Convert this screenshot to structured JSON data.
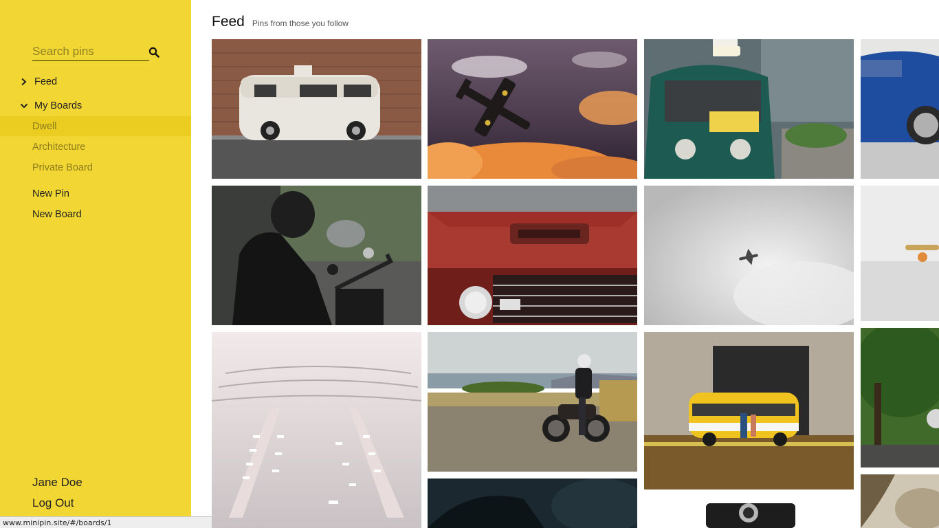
{
  "search": {
    "placeholder": "Search pins",
    "value": ""
  },
  "nav": {
    "feed": "Feed",
    "my_boards": "My Boards",
    "boards": [
      "Dwell",
      "Architecture",
      "Private Board"
    ],
    "new_pin": "New Pin",
    "new_board": "New Board"
  },
  "user": {
    "name": "Jane Doe",
    "logout": "Log Out"
  },
  "status_url": "www.minipin.site/#/boards/1",
  "header": {
    "title": "Feed",
    "subtitle": "Pins from those you follow"
  },
  "colors": {
    "sidebar": "#f2d633",
    "active_board": "#ebcd22",
    "board_text": "#8c7c1c"
  },
  "icons": {
    "search": "search-icon",
    "collapsed": "chevron-right-icon",
    "expanded": "chevron-down-icon"
  },
  "pins": [
    "white-van-photo",
    "airplane-sunset-photo",
    "tuk-tuk-taxi-photo",
    "blue-car-photo",
    "motorcyclist-photo",
    "red-truck-photo",
    "plane-in-sky-photo",
    "skateboard-photo",
    "airport-aerial-photo",
    "motorcycle-rider-photo",
    "yellow-van-photo",
    "trees-car-photo",
    "dark-car-photo",
    "camera-photo",
    "sepia-photo"
  ]
}
